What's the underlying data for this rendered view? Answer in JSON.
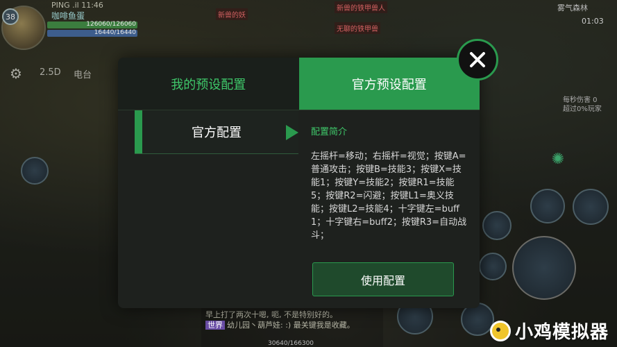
{
  "hud": {
    "ping": "PING .il 11:46",
    "player_name": "咖啡鱼蛋",
    "level": "38",
    "hp": "126060/126060",
    "mp": "16440/16440",
    "mode": "2.5D",
    "radio": "电台",
    "map": "雾气森林",
    "time": "01:03",
    "dps": [
      "每秒伤害 0",
      "超过0%玩家"
    ],
    "enemies": [
      "新兽的妖",
      "新兽的铁甲兽人",
      "无聊的铁甲兽"
    ],
    "chat": {
      "line1": "早上打了两次十嗯, 呃, 不是特别好的。",
      "tag": "世界",
      "line2": "幼儿园丶葫芦娃: :) 最关键我是收藏。"
    },
    "exp": "30640/166300",
    "watermark": "小鸡模拟器"
  },
  "modal": {
    "tabs": [
      {
        "label": "我的预设配置",
        "active": false
      },
      {
        "label": "官方预设配置",
        "active": true
      }
    ],
    "side_items": [
      {
        "label": "官方配置",
        "selected": true
      }
    ],
    "detail": {
      "title": "配置简介",
      "description": "左摇杆=移动；右摇杆=视觉；按键A=普通攻击；按键B=技能3；按键X=技能1；按键Y=技能2；按键R1=技能5；按键R2=闪避；按键L1=奥义技能；按键L2=技能4；十字键左=buff1；十字键右=buff2；按键R3=自动战斗；"
    },
    "use_button": "使用配置",
    "colors": {
      "accent": "#2a9a4e",
      "accent_text": "#3fc86a",
      "panel": "#1e211e"
    }
  }
}
